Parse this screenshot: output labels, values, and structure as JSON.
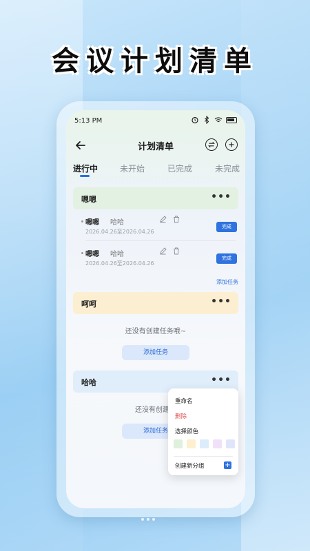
{
  "promo": {
    "title": "会议计划清单"
  },
  "status_bar": {
    "time": "5:13 PM"
  },
  "header": {
    "title": "计划清单"
  },
  "tabs": [
    {
      "label": "进行中",
      "active": true
    },
    {
      "label": "未开始",
      "active": false
    },
    {
      "label": "已完成",
      "active": false
    },
    {
      "label": "未完成",
      "active": false
    }
  ],
  "groups": [
    {
      "name": "嗯嗯",
      "color": "#e3f1e2",
      "more": "•••",
      "tasks": [
        {
          "title": "嗯嗯",
          "subtitle": "哈哈",
          "date": "2026.04.26至2026.04.26",
          "action": "完成"
        },
        {
          "title": "嗯嗯",
          "subtitle": "哈哈",
          "date": "2026.04.26至2026.04.26",
          "action": "完成"
        }
      ],
      "add_task": "添加任务"
    },
    {
      "name": "呵呵",
      "color": "#fcefd1",
      "more": "•••",
      "empty_text": "还没有创建任务哦~",
      "add_task": "添加任务"
    },
    {
      "name": "哈哈",
      "color": "#dfeefa",
      "more": "•••",
      "empty_text": "还没有创建任",
      "add_task": "添加任务"
    }
  ],
  "menu": {
    "rename": "重命名",
    "delete": "删除",
    "choose_color": "选择颜色",
    "swatches": [
      "#dff0dc",
      "#fdf0cf",
      "#dcecfb",
      "#f0e1f8",
      "#dfe6fb"
    ],
    "new_group": "创建新分组",
    "new_group_icon": "+"
  },
  "colors": {
    "accent": "#2f72e0",
    "danger": "#e05252"
  }
}
